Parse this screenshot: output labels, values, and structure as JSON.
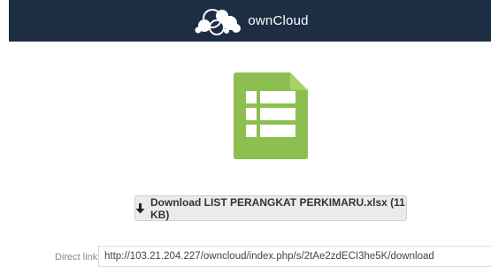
{
  "header": {
    "brand_name": "ownCloud",
    "logo_icon": "owncloud-cloud-icon",
    "background": "#1d2d44"
  },
  "file": {
    "icon": "spreadsheet-file-icon",
    "icon_color": "#8cbf4f"
  },
  "download": {
    "icon": "download-arrow-icon",
    "label": "Download LIST PERANGKAT PERKIMARU.xlsx (11 KB)"
  },
  "direct_link": {
    "label": "Direct link",
    "value": "http://103.21.204.227/owncloud/index.php/s/2tAe2zdECI3he5K/download"
  }
}
